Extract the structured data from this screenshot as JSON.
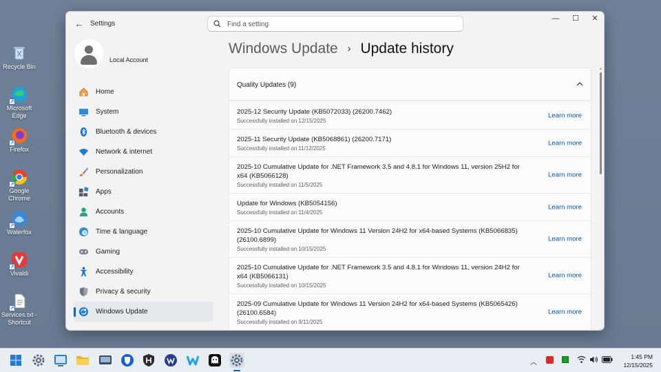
{
  "desktop": {
    "icons": [
      {
        "label": "Recycle Bin",
        "icon": "recycle-bin-icon",
        "color": "#8fb3d9"
      },
      {
        "label": "Microsoft Edge",
        "icon": "edge-icon",
        "color": "#1fa2d6"
      },
      {
        "label": "Firefox",
        "icon": "firefox-icon",
        "color": "#f76d1f"
      },
      {
        "label": "Google Chrome",
        "icon": "chrome-icon",
        "color": "#e6402f"
      },
      {
        "label": "Waterfox",
        "icon": "waterfox-icon",
        "color": "#3a88d8"
      },
      {
        "label": "Vivaldi",
        "icon": "vivaldi-icon",
        "color": "#e33b3b"
      },
      {
        "label": "Services.txt - Shortcut",
        "icon": "text-file-icon",
        "color": "#f2f2f2"
      }
    ]
  },
  "window": {
    "app_title": "Settings",
    "search": {
      "placeholder": "Find a setting"
    },
    "controls": {
      "minimize": "—",
      "maximize": "☐",
      "close": "✕"
    }
  },
  "account": {
    "name": "Local Account"
  },
  "sidebar": {
    "items": [
      {
        "label": "Home",
        "icon": "home-icon",
        "color": "#e8813a"
      },
      {
        "label": "System",
        "icon": "system-icon",
        "color": "#2c8fd6"
      },
      {
        "label": "Bluetooth & devices",
        "icon": "bluetooth-icon",
        "color": "#1672c9"
      },
      {
        "label": "Network & internet",
        "icon": "wifi-icon",
        "color": "#1a7fd4"
      },
      {
        "label": "Personalization",
        "icon": "brush-icon",
        "color": "#d96b2b"
      },
      {
        "label": "Apps",
        "icon": "apps-icon",
        "color": "#4a5a75"
      },
      {
        "label": "Accounts",
        "icon": "accounts-icon",
        "color": "#23a38a"
      },
      {
        "label": "Time & language",
        "icon": "clock-globe-icon",
        "color": "#2f8fd0"
      },
      {
        "label": "Gaming",
        "icon": "gamepad-icon",
        "color": "#7d8794"
      },
      {
        "label": "Accessibility",
        "icon": "accessibility-icon",
        "color": "#1d6fc7"
      },
      {
        "label": "Privacy & security",
        "icon": "shield-icon",
        "color": "#6f7680"
      },
      {
        "label": "Windows Update",
        "icon": "update-icon",
        "color": "#1d7ad8",
        "active": true
      }
    ]
  },
  "breadcrumb": {
    "parent": "Windows Update",
    "separator": "›",
    "current": "Update history"
  },
  "group": {
    "title": "Quality Updates (9)"
  },
  "updates": [
    {
      "title": "2025-12 Security Update (KB5072033) (26200.7462)",
      "status": "Successfully installed on 12/15/2025",
      "link": "Learn more"
    },
    {
      "title": "2025-11 Security Update (KB5068861) (26200.7171)",
      "status": "Successfully installed on 11/12/2025",
      "link": "Learn more"
    },
    {
      "title": "2025-10 Cumulative Update for .NET Framework 3.5 and 4.8.1 for Windows 11, version 25H2 for x64 (KB5066128)",
      "status": "Successfully installed on 11/5/2025",
      "link": "Learn more"
    },
    {
      "title": "Update for Windows (KB5054156)",
      "status": "Successfully installed on 11/4/2025",
      "link": "Learn more"
    },
    {
      "title": "2025-10 Cumulative Update for Windows 11 Version 24H2 for x64-based Systems (KB5066835) (26100.6899)",
      "status": "Successfully installed on 10/15/2025",
      "link": "Learn more"
    },
    {
      "title": "2025-10 Cumulative Update for .NET Framework 3.5 and 4.8.1 for Windows 11, version 24H2 for x64 (KB5066131)",
      "status": "Successfully installed on 10/15/2025",
      "link": "Learn more"
    },
    {
      "title": "2025-09 Cumulative Update for Windows 11 Version 24H2 for x64-based Systems (KB5065426) (26100.6584)",
      "status": "Successfully installed on 9/11/2025",
      "link": "Learn more"
    }
  ],
  "taskbar": {
    "apps": [
      {
        "name": "start-button",
        "color": "#1f7ad8"
      },
      {
        "name": "settings-gear-taskbar",
        "color": "#5a6b80"
      },
      {
        "name": "control-panel-taskbar",
        "color": "#2b7fd1"
      },
      {
        "name": "file-explorer-taskbar",
        "color": "#f0b429"
      },
      {
        "name": "remote-desktop-taskbar",
        "color": "#3b4b60"
      },
      {
        "name": "bitwarden-taskbar",
        "color": "#175ddc"
      },
      {
        "name": "hardened-app-taskbar",
        "color": "#2b2b2b"
      },
      {
        "name": "waterfox-taskbar",
        "color": "#2a3e8f"
      },
      {
        "name": "w-app-taskbar",
        "color": "#20a3e0"
      },
      {
        "name": "ghost-app-taskbar",
        "color": "#111111"
      },
      {
        "name": "settings-active-taskbar",
        "color": "#5a6b80"
      }
    ],
    "clock": {
      "time": "1:45 PM",
      "date": "12/15/2025"
    }
  }
}
